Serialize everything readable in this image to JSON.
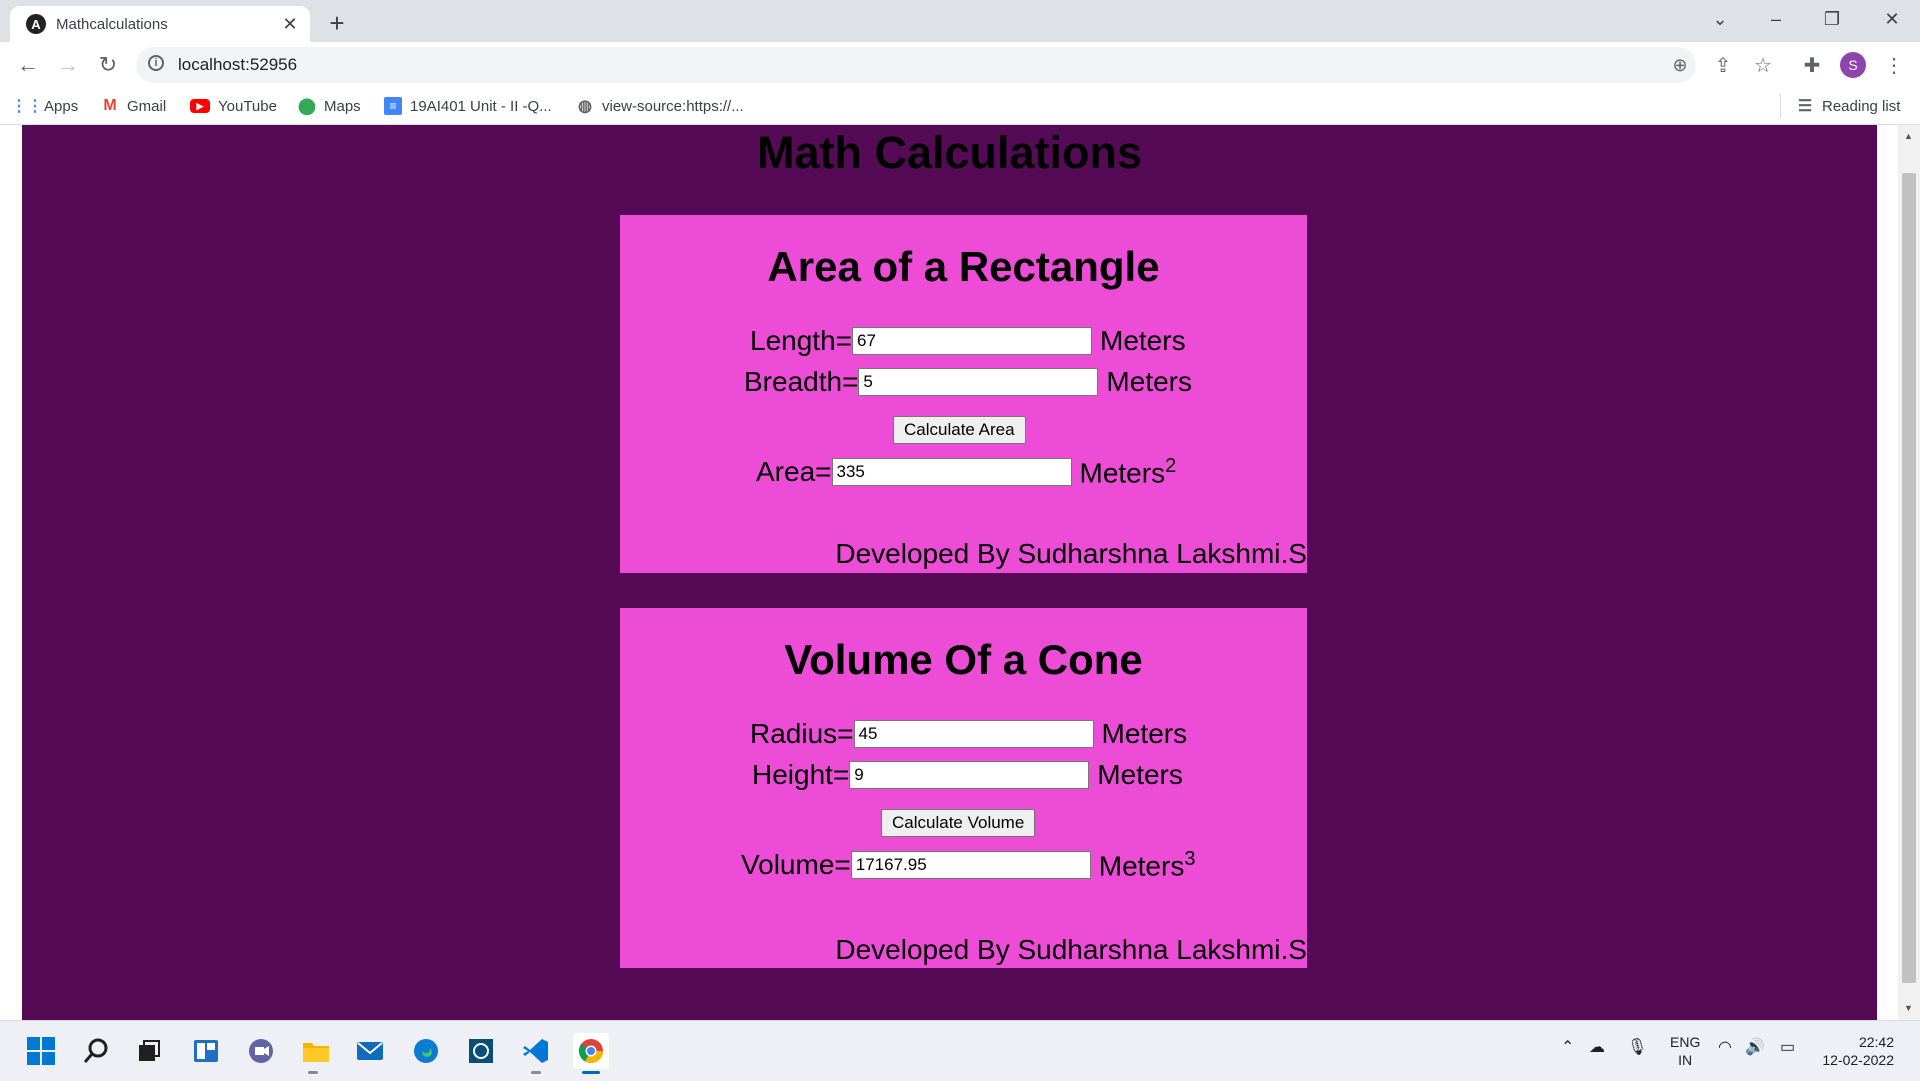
{
  "browser": {
    "tab_title": "Mathcalculations",
    "tab_favicon": "A",
    "url": "localhost:52956",
    "profile_initial": "S",
    "bookmarks": [
      "Apps",
      "Gmail",
      "YouTube",
      "Maps",
      "19AI401 Unit - II -Q...",
      "view-source:https://..."
    ],
    "reading_list": "Reading list"
  },
  "page": {
    "heading": "Math Calculations",
    "background_color": "#540a54",
    "card_color": "#ec4cd6",
    "rectangle": {
      "title": "Area of a Rectangle",
      "length_label": "Length=",
      "length_value": "67",
      "breadth_label": "Breadth=",
      "breadth_value": "5",
      "unit": "Meters",
      "button": "Calculate Area",
      "area_label": "Area=",
      "area_value": "335",
      "area_unit": "Meters",
      "area_power": "2",
      "credit": "Developed By Sudharshna Lakshmi.S"
    },
    "cone": {
      "title": "Volume Of a Cone",
      "radius_label": "Radius=",
      "radius_value": "45",
      "height_label": "Height=",
      "height_value": "9",
      "unit": "Meters",
      "button": "Calculate Volume",
      "volume_label": "Volume=",
      "volume_value": "17167.95",
      "volume_unit": "Meters",
      "volume_power": "3",
      "credit": "Developed By Sudharshna Lakshmi.S"
    }
  },
  "taskbar": {
    "language": "ENG",
    "region": "IN",
    "time": "22:42",
    "date": "12-02-2022"
  }
}
